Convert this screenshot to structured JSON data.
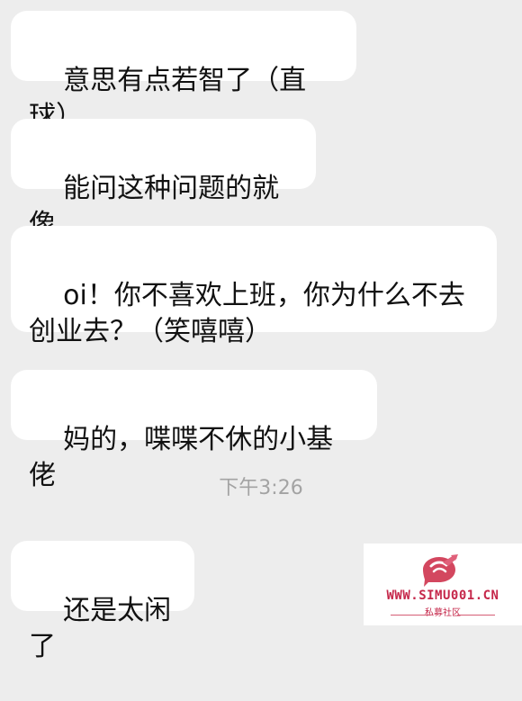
{
  "messages": [
    {
      "text": "意思有点若智了（直球）"
    },
    {
      "text": "能问这种问题的就像"
    },
    {
      "text": "oi！你不喜欢上班，你为什么不去\n创业去？（笑嘻嘻）"
    },
    {
      "text": "妈的，喋喋不休的小基佬"
    },
    {
      "text": "还是太闲了"
    }
  ],
  "timestamp": "下午3:26",
  "watermark": {
    "site": "WWW.SIMU001.CN",
    "subtitle": "私募社区",
    "logo_icon": "chat-bubble-logo-icon",
    "color": "#c5274a"
  }
}
